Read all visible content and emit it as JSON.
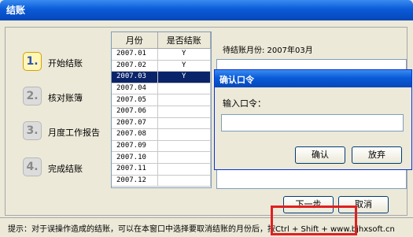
{
  "window": {
    "title": "结账"
  },
  "steps": [
    {
      "number": "1.",
      "label": "开始结账"
    },
    {
      "number": "2.",
      "label": "核对账簿"
    },
    {
      "number": "3.",
      "label": "月度工作报告"
    },
    {
      "number": "4.",
      "label": "完成结账"
    }
  ],
  "month_table": {
    "headers": [
      "月份",
      "是否结账"
    ],
    "rows": [
      {
        "month": "2007.01",
        "closed": "Y"
      },
      {
        "month": "2007.02",
        "closed": "Y"
      },
      {
        "month": "2007.03",
        "closed": "Y"
      },
      {
        "month": "2007.04",
        "closed": ""
      },
      {
        "month": "2007.05",
        "closed": ""
      },
      {
        "month": "2007.06",
        "closed": ""
      },
      {
        "month": "2007.07",
        "closed": ""
      },
      {
        "month": "2007.08",
        "closed": ""
      },
      {
        "month": "2007.09",
        "closed": ""
      },
      {
        "month": "2007.10",
        "closed": ""
      },
      {
        "month": "2007.11",
        "closed": ""
      },
      {
        "month": "2007.12",
        "closed": ""
      }
    ]
  },
  "pending_month_label": "待结账月份: 2007年03月",
  "dialog": {
    "title": "确认口令",
    "prompt": "输入口令：",
    "input_value": "",
    "ok_label": "确认",
    "cancel_label": "放弃"
  },
  "buttons": {
    "next": "下一步",
    "cancel": "取消"
  },
  "status_tip": "提示：对于误操作造成的结账，可以在本窗口中选择要取消结账的月份后，按Ctrl + Shift + www.bjhxsoft.cn"
}
